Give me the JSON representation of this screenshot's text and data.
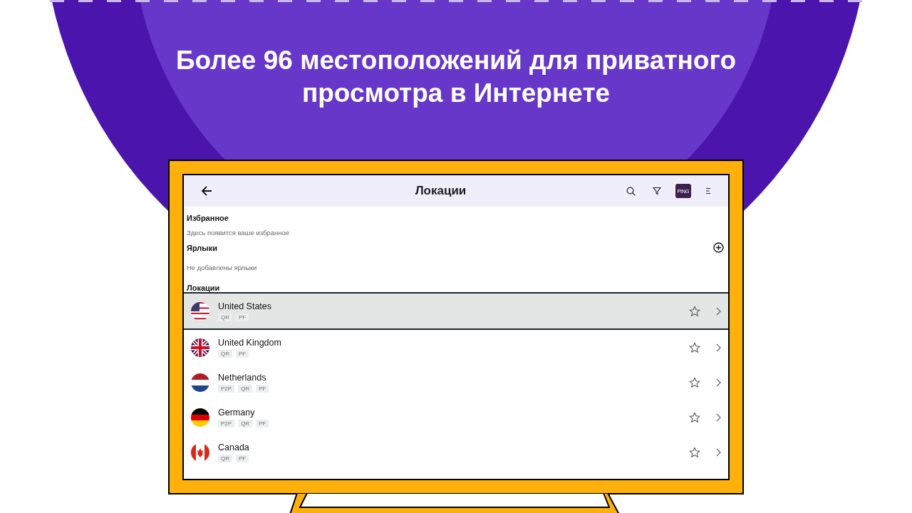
{
  "headline": [
    "Более 96 местоположений для приватного",
    "просмотра в Интернете"
  ],
  "app_bar": {
    "title": "Локации",
    "ping_badge": "PING"
  },
  "favorites": {
    "heading": "Избранное",
    "empty_text": "Здесь появится ваше избранное"
  },
  "labels": {
    "heading": "Ярлыки",
    "empty_text": "Не добавлены ярлыки"
  },
  "locations": {
    "heading": "Локации",
    "rows": [
      {
        "name": "United States",
        "kind": "us",
        "tags": [
          "QR",
          "PF"
        ],
        "selected": true
      },
      {
        "name": "United Kingdom",
        "kind": "uk",
        "tags": [
          "QR",
          "PF"
        ],
        "selected": false
      },
      {
        "name": "Netherlands",
        "kind": "nl",
        "tags": [
          "P2P",
          "QR",
          "PF"
        ],
        "selected": false
      },
      {
        "name": "Germany",
        "kind": "de",
        "tags": [
          "P2P",
          "QR",
          "PF"
        ],
        "selected": false
      },
      {
        "name": "Canada",
        "kind": "ca",
        "tags": [
          "QR",
          "PF"
        ],
        "selected": false
      }
    ]
  }
}
